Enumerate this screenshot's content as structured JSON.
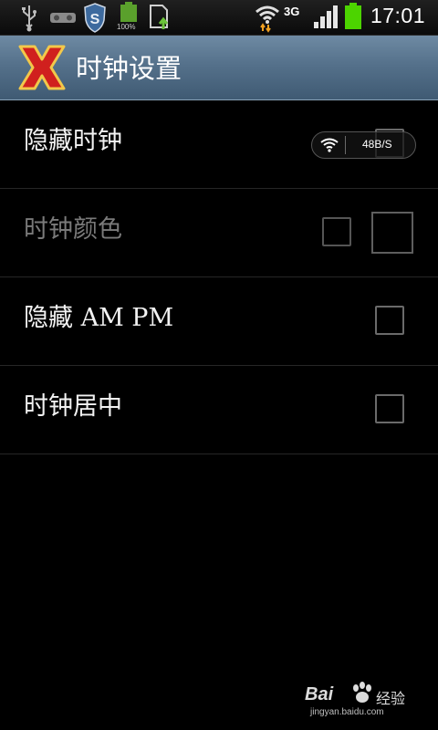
{
  "status_bar": {
    "time": "17:01",
    "network_type": "3G",
    "battery_small_pct": "100%",
    "icons": [
      "usb-icon",
      "voicemail-icon",
      "shield-s-icon",
      "battery-small-icon",
      "sd-upload-icon",
      "wifi-icon",
      "signal-icon",
      "battery-icon"
    ]
  },
  "title_bar": {
    "title": "时钟设置",
    "logo_icon": "x-logo-icon"
  },
  "preferences": [
    {
      "label": "隐藏时钟",
      "enabled": true,
      "checked": false
    },
    {
      "label": "时钟颜色",
      "enabled": false,
      "checked": false
    },
    {
      "label": "隐藏 AM PM",
      "enabled": true,
      "checked": false
    },
    {
      "label": "时钟居中",
      "enabled": true,
      "checked": false
    }
  ],
  "speed_widget": {
    "speed": "48B/S"
  },
  "watermark": {
    "brand": "Bai",
    "cn": "经验",
    "url": "jingyan.baidu.com"
  },
  "colors": {
    "title_bar": "#55718b",
    "background": "#000000",
    "battery_green": "#4cd400"
  }
}
